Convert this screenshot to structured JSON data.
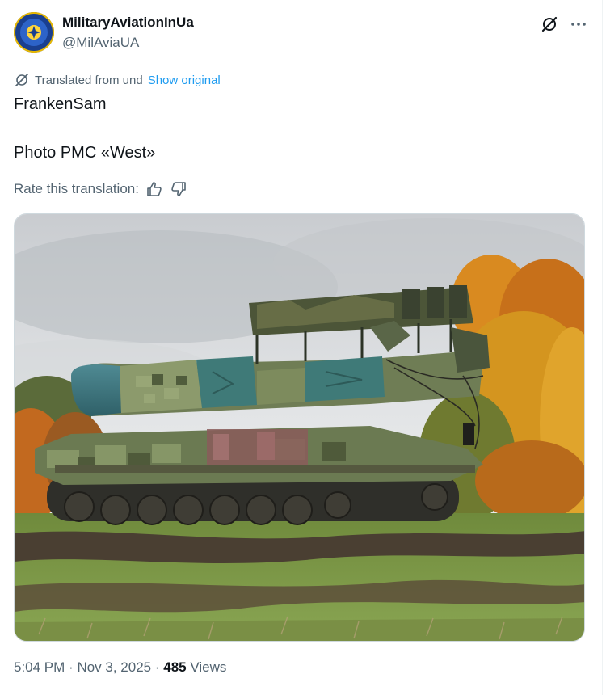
{
  "author": {
    "display_name": "MilitaryAviationInUa",
    "handle": "@MilAviaUA"
  },
  "translation": {
    "label": "Translated from und",
    "show_original": "Show original",
    "rate_label": "Rate this translation:"
  },
  "post": {
    "lines": [
      "FrankenSam",
      "Photo PMC «West»"
    ]
  },
  "media": {
    "alt": "Camouflaged tracked air defense launcher vehicle in a field with autumn trees"
  },
  "meta": {
    "time": "5:04 PM",
    "date": "Nov 3, 2025",
    "views_count": "485",
    "views_label": "Views"
  },
  "colors": {
    "accent": "#1d9bf0",
    "secondary_text": "#536471",
    "primary_text": "#0f1419"
  }
}
